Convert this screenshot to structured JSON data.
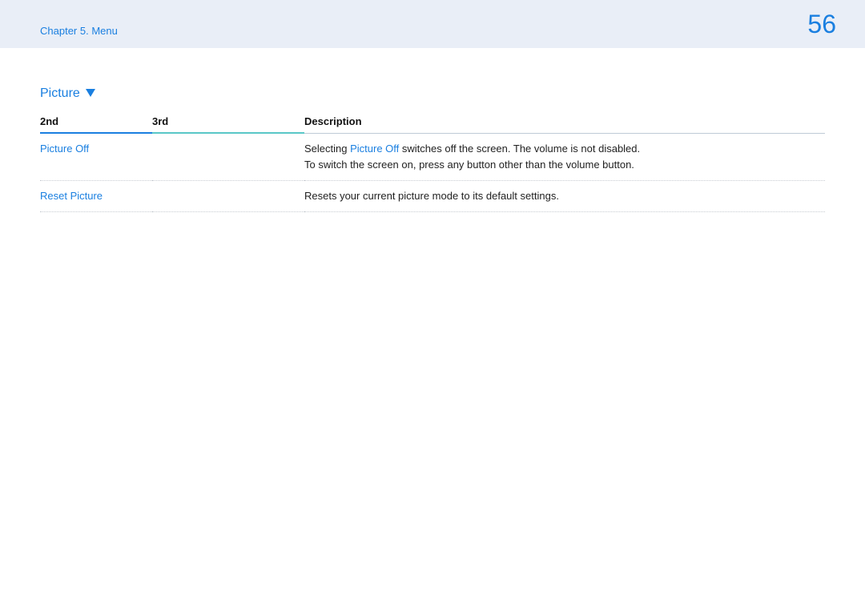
{
  "header": {
    "chapter": "Chapter 5. Menu",
    "page_number": "56"
  },
  "section": {
    "title": "Picture"
  },
  "table": {
    "columns": [
      "2nd",
      "3rd",
      "Description"
    ],
    "rows": [
      {
        "second": "Picture Off",
        "third": "",
        "desc_prefix": "Selecting ",
        "desc_hl": "Picture Off",
        "desc_suffix": " switches off the screen. The volume is not disabled.",
        "desc_line2": "To switch the screen on, press any button other than the volume button."
      },
      {
        "second": "Reset Picture",
        "third": "",
        "desc_prefix": "Resets your current picture mode to its default settings.",
        "desc_hl": "",
        "desc_suffix": "",
        "desc_line2": ""
      }
    ]
  }
}
